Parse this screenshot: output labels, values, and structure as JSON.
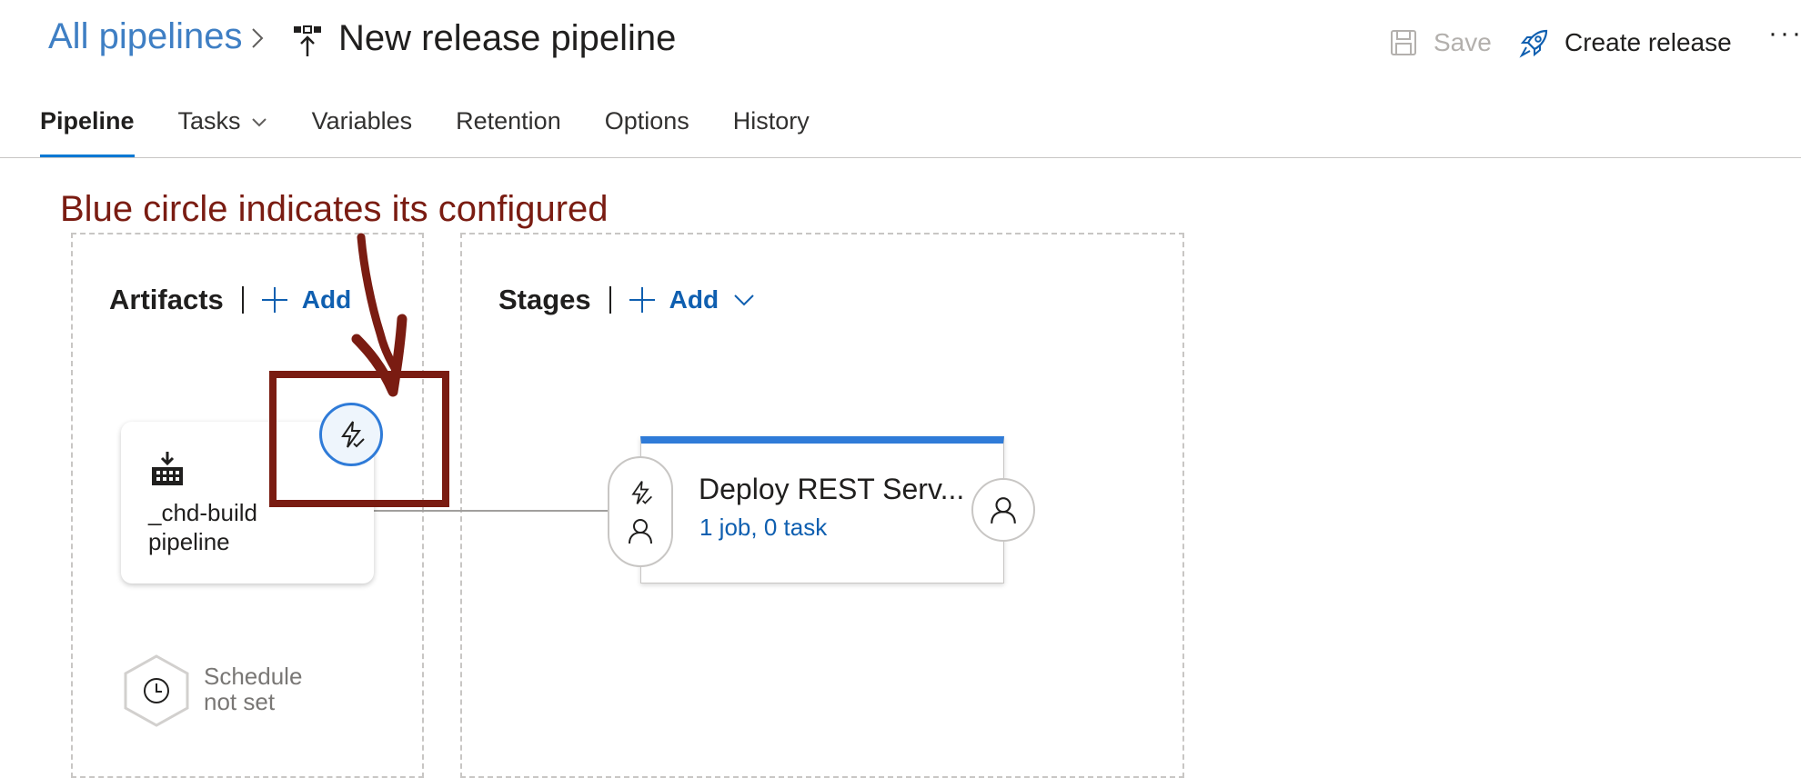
{
  "header": {
    "breadcrumb_link": "All pipelines",
    "pipeline_title": "New release pipeline",
    "save_label": "Save",
    "create_release_label": "Create release",
    "more_label": "···"
  },
  "tabs": [
    {
      "label": "Pipeline",
      "active": true
    },
    {
      "label": "Tasks",
      "has_dropdown": true
    },
    {
      "label": "Variables"
    },
    {
      "label": "Retention"
    },
    {
      "label": "Options"
    },
    {
      "label": "History"
    }
  ],
  "annotation": {
    "text": "Blue circle indicates its configured",
    "color": "#7a1c12"
  },
  "artifacts": {
    "title": "Artifacts",
    "add_label": "Add",
    "artifact_name": "_chd-build pipeline",
    "trigger_icon": "lightning-icon",
    "schedule_text": "Schedule not set"
  },
  "stages": {
    "title": "Stages",
    "add_label": "Add",
    "stage_name": "Deploy REST Serv...",
    "stage_summary": "1 job, 0 task"
  },
  "colors": {
    "accent": "#0078d4",
    "link": "#0f5fb0",
    "breadcrumb": "#3f7fc4",
    "configured_ring": "#2f7bd8"
  }
}
